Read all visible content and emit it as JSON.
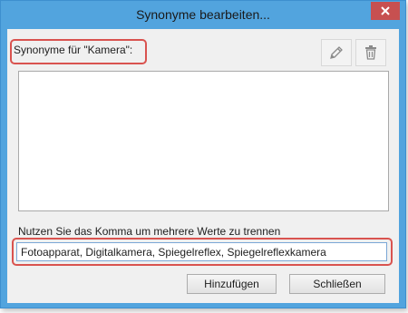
{
  "window": {
    "title": "Synonyme bearbeiten...",
    "accent_color": "#52a4de",
    "close_color": "#c75050"
  },
  "synonyms": {
    "label": "Synonyme für \"Kamera\":",
    "edit_icon": "pencil-icon",
    "delete_icon": "trash-icon",
    "items": []
  },
  "hint": "Nutzen Sie das Komma um mehrere Werte zu trennen",
  "input": {
    "value": "Fotoapparat, Digitalkamera, Spiegelreflex, Spiegelreflexkamera"
  },
  "buttons": {
    "add": "Hinzufügen",
    "close": "Schließen"
  },
  "highlight_color": "#d9534f"
}
